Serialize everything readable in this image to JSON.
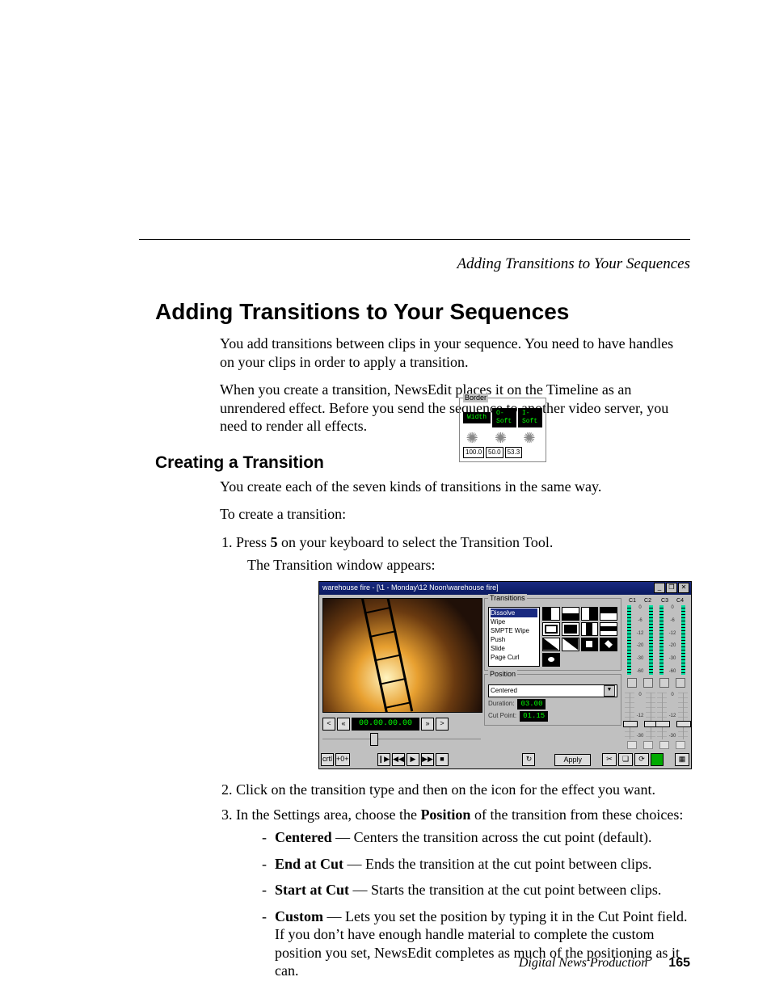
{
  "running_head": "Adding Transitions to Your Sequences",
  "h1": "Adding Transitions to Your Sequences",
  "intro_p1": "You add transitions between clips in your sequence. You need to have handles on your clips in order to apply a transition.",
  "intro_p2": "When you create a transition, NewsEdit places it on the Timeline as an unrendered effect. Before you send the sequence to another video server, you need to render all effects.",
  "h2": "Creating a Transition",
  "sub_p1": "You create each of the seven kinds of transitions in the same way.",
  "sub_p2": "To create a transition:",
  "step1_pre": "Press ",
  "step1_key": "5",
  "step1_post": " on your keyboard to select the Transition Tool.",
  "step1_sub": "The Transition window appears:",
  "step2": "Click on the transition type and then on the icon for the effect you want.",
  "step3_pre": "In the Settings area, choose the ",
  "step3_bold": "Position",
  "step3_post": " of the transition from these choices:",
  "opt_centered_label": "Centered",
  "opt_centered_desc": " — Centers the transition across the cut point (default).",
  "opt_end_label": "End at Cut",
  "opt_end_desc": " — Ends the transition at the cut point between clips.",
  "opt_start_label": "Start at Cut",
  "opt_start_desc": " — Starts the transition at the cut point between clips.",
  "opt_custom_label": "Custom",
  "opt_custom_desc": " — Lets you set the position by typing it in the Cut Point field. If you don’t have enough handle material to complete the custom position you set, NewsEdit completes as much of the positioning as it can.",
  "footer_book": "Digital News Production",
  "footer_page": "165",
  "win": {
    "title": "warehouse fire - [\\1 - Monday\\12 Noon\\warehouse fire]",
    "min": "_",
    "max": "❐",
    "close": "✕",
    "timecode": "00.00.00.00",
    "tc_prev": "<",
    "tc_rew": "«",
    "tc_ff": "»",
    "tc_next": ">",
    "mark_in": "crtl",
    "mark_out": "+0+",
    "play_start": "❙▶",
    "play_prev": "◀◀",
    "play": "▶",
    "play_next": "▶▶",
    "stop": "■",
    "loop": "↻",
    "trans_title": "Transitions",
    "trans_items": [
      "Dissolve",
      "Wipe",
      "SMPTE Wipe",
      "Push",
      "Slide",
      "Page Curl"
    ],
    "pos_title": "Position",
    "pos_value": "Centered",
    "dur_label": "Duration:",
    "dur_value": "03.00",
    "cut_label": "Cut Point:",
    "cut_value": "01.15",
    "border_title": "Border",
    "chip_width": "Width",
    "chip_osoft": "O-Soft",
    "chip_isoft": "I-Soft",
    "spin_a": "100.0",
    "spin_b": "50.0",
    "spin_c": "53.3",
    "apply": "Apply",
    "fx1": "✂",
    "fx2": "❏",
    "fx3": "⟳",
    "fx4": "▦",
    "ch": [
      "C1",
      "C2",
      "C3",
      "C4"
    ],
    "scale": [
      "0",
      "-6",
      "-12",
      "-20",
      "-30",
      "-60"
    ]
  }
}
